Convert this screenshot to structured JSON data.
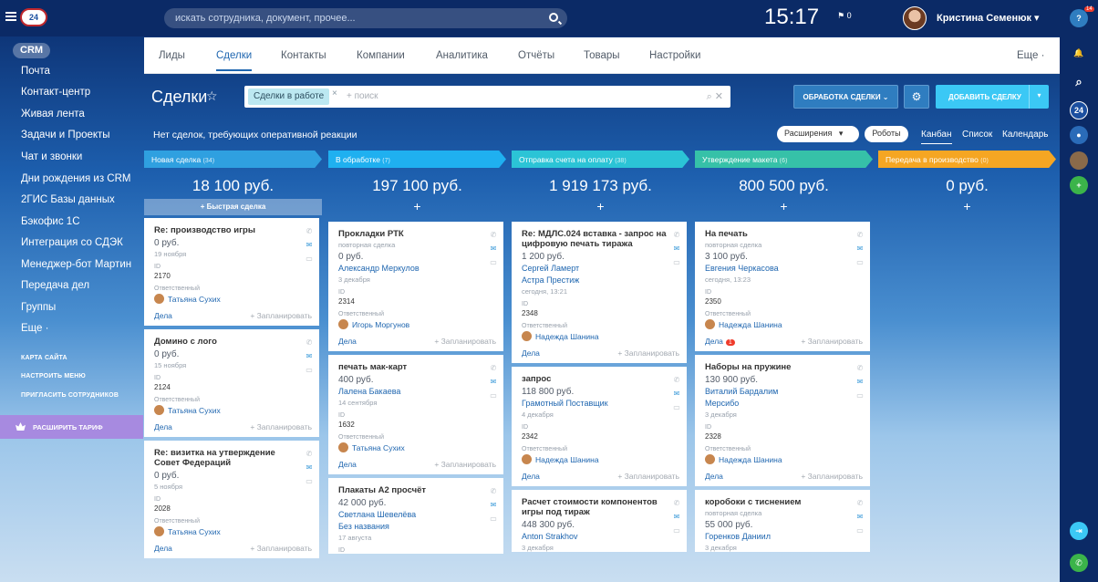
{
  "topbar": {
    "search_placeholder": "искать сотрудника, документ, прочее...",
    "clock": "15:17",
    "flag_count": "0",
    "user_name": "Кристина Семенюк",
    "logo_text": "24"
  },
  "sidebar": {
    "crm": "CRM",
    "items": [
      "Почта",
      "Контакт-центр",
      "Живая лента",
      "Задачи и Проекты",
      "Чат и звонки",
      "Дни рождения из CRM",
      "2ГИС Базы данных",
      "Бэкофис 1С",
      "Интеграция со СДЭК",
      "Менеджер-бот Мартин",
      "Передача дел",
      "Группы",
      "Еще ·"
    ],
    "small": [
      "КАРТА САЙТА",
      "НАСТРОИТЬ МЕНЮ",
      "ПРИГЛАСИТЬ СОТРУДНИКОВ"
    ],
    "upgrade": "РАСШИРИТЬ ТАРИФ"
  },
  "rightbar": {
    "notif_count": "14",
    "counter": "24"
  },
  "tabs": [
    "Лиды",
    "Сделки",
    "Контакты",
    "Компании",
    "Аналитика",
    "Отчёты",
    "Товары",
    "Настройки"
  ],
  "tabs_more": "Еще ·",
  "toolbar": {
    "title": "Сделки",
    "filter_chip": "Сделки в работе",
    "filter_chip_close": "×",
    "filter_placeholder": "+ поиск",
    "process_btn": "ОБРАБОТКА СДЕЛКИ",
    "add_btn": "ДОБАВИТЬ СДЕЛКУ"
  },
  "subbar": {
    "notice": "Нет сделок, требующих оперативной реакции",
    "extensions": "Расширения",
    "robots": "Роботы",
    "views": [
      "Канбан",
      "Список",
      "Календарь"
    ]
  },
  "labels": {
    "quick": "+ Быстрая сделка",
    "id": "ID",
    "responsible": "Ответственный",
    "deals": "Дела",
    "plan": "+ Запланировать",
    "add": "+"
  },
  "colors": {
    "c1": "#2fa0e0",
    "c2": "#1fb0f0",
    "c3": "#2bc4d6",
    "c4": "#36c1a8",
    "c5": "#f5a623"
  },
  "columns": [
    {
      "name": "Новая сделка",
      "count": "(34)",
      "sum": "18 100 руб.",
      "cards": [
        {
          "title": "Re: производство игры",
          "price": "0 руб.",
          "date": "19 ноября",
          "id": "2170",
          "resp": "Татьяна Сухих"
        },
        {
          "title": "Домино с лого",
          "price": "0 руб.",
          "date": "15 ноября",
          "id": "2124",
          "resp": "Татьяна Сухих"
        },
        {
          "title": "Re: визитка на утверждение Совет Федераций",
          "price": "0 руб.",
          "date": "5 ноября",
          "id": "2028",
          "resp": "Татьяна Сухих"
        }
      ]
    },
    {
      "name": "В обработке",
      "count": "(7)",
      "sum": "197 100 руб.",
      "cards": [
        {
          "title": "Прокладки РТК",
          "sub": "повторная сделка",
          "price": "0 руб.",
          "client": "Александр Меркулов",
          "date": "3 декабря",
          "id": "2314",
          "resp": "Игорь Моргунов"
        },
        {
          "title": "печать мак-карт",
          "price": "400 руб.",
          "client": "Лалена Бакаева",
          "date": "14 сентября",
          "id": "1632",
          "resp": "Татьяна Сухих"
        },
        {
          "title": "Плакаты А2 просчёт",
          "price": "42 000 руб.",
          "client": "Светлана Шевелёва\nБез названия",
          "date": "17 августа",
          "id": ""
        }
      ]
    },
    {
      "name": "Отправка счета на оплату",
      "count": "(38)",
      "sum": "1 919 173 руб.",
      "cards": [
        {
          "title": "Re: МДЛС.024 вставка - запрос на цифровую печать тиража",
          "price": "1 200 руб.",
          "client": "Сергей Ламерт\nАстра Престиж",
          "date": "сегодня, 13:21",
          "id": "2348",
          "resp": "Надежда Шанина"
        },
        {
          "title": "запрос",
          "price": "118 800 руб.",
          "client": "Грамотный Поставщик",
          "date": "4 декабря",
          "id": "2342",
          "resp": "Надежда Шанина"
        },
        {
          "title": "Расчет стоимости компонентов игры под тираж",
          "price": "448 300 руб.",
          "client": "Anton Strakhov",
          "date": "3 декабря"
        }
      ]
    },
    {
      "name": "Утверждение макета",
      "count": "(6)",
      "sum": "800 500 руб.",
      "cards": [
        {
          "title": "На печать",
          "sub": "повторная сделка",
          "price": "3 100 руб.",
          "client": "Евгения Черкасова",
          "date": "сегодня, 13:23",
          "id": "2350",
          "resp": "Надежда Шанина",
          "badge": "1"
        },
        {
          "title": "Наборы на пружине",
          "price": "130 900 руб.",
          "client": "Виталий Бардалим\nМерсибо",
          "date": "3 декабря",
          "id": "2328",
          "resp": "Надежда Шанина"
        },
        {
          "title": "коробоки с тиснением",
          "sub": "повторная сделка",
          "price": "55 000 руб.",
          "client": "Горенков Даниил",
          "date": "3 декабря"
        }
      ]
    },
    {
      "name": "Передача в производство",
      "count": "(0)",
      "sum": "0 руб.",
      "cards": []
    }
  ]
}
